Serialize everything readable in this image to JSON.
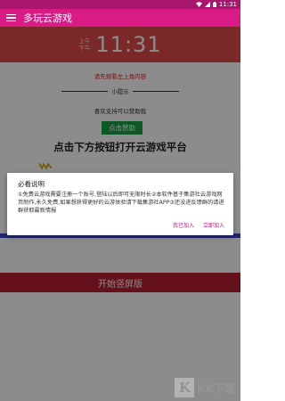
{
  "status_bar": {
    "time": "11:31",
    "wifi_icon": "wifi-icon",
    "signal_icon": "signal-icon",
    "battery_icon": "battery-icon"
  },
  "app_bar": {
    "title": "多玩云游戏",
    "menu_icon": "menu-icon"
  },
  "clock": {
    "am": "上午",
    "pm": "下午",
    "time": "11:31"
  },
  "notice_link": "请先观看左上角内容",
  "tip": {
    "heading": "小提示",
    "body": "喜欢支持可以赞助我"
  },
  "donate_button": "点击赞助",
  "main_heading": "点击下方按钮打开云游戏平台",
  "deco_icon": "zigzag-icon",
  "portrait_button": "开始竖屏版",
  "dialog": {
    "title": "必看说明",
    "body": "①免费云游戏需要注册一个账号,登陆以后即可无限时长②本软件基于集游社云游戏网页制作,永久免费,如果想获得更好的云游体验请下载集游社APP③还没进反馈群的请进群获取最新情报",
    "action_later": "我已加入",
    "action_join": "立即加入"
  },
  "watermark": {
    "box": "K",
    "text": "KK下载"
  },
  "colors": {
    "status_bar": "#a8166e",
    "app_bar": "#d81b85",
    "clock_panel": "#e04a4a",
    "donate": "#1aa04a",
    "portrait": "#b71f33",
    "accent": "#c0157a"
  }
}
